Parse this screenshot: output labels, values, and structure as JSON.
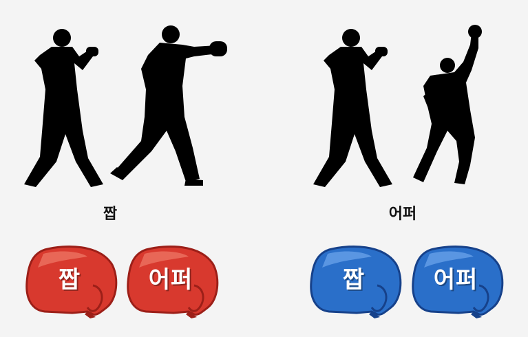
{
  "scenes": {
    "jab": {
      "caption": "짭"
    },
    "upper": {
      "caption": "어퍼"
    }
  },
  "buttons": {
    "red": {
      "jab": "짭",
      "upper": "어퍼"
    },
    "blue": {
      "jab": "짭",
      "upper": "어퍼"
    }
  },
  "colors": {
    "background": "#f4f4f4",
    "silhouette": "#000000",
    "red_glove": "#d8392e",
    "red_glove_dark": "#9c1f18",
    "red_glove_light": "#f07a6a",
    "blue_glove": "#2a6fc9",
    "blue_glove_dark": "#16418a",
    "blue_glove_light": "#6fa7ec"
  },
  "icons": [
    "boxer-guard-silhouette",
    "boxer-jab-silhouette",
    "boxer-uppercut-silhouette",
    "boxing-glove-icon"
  ]
}
